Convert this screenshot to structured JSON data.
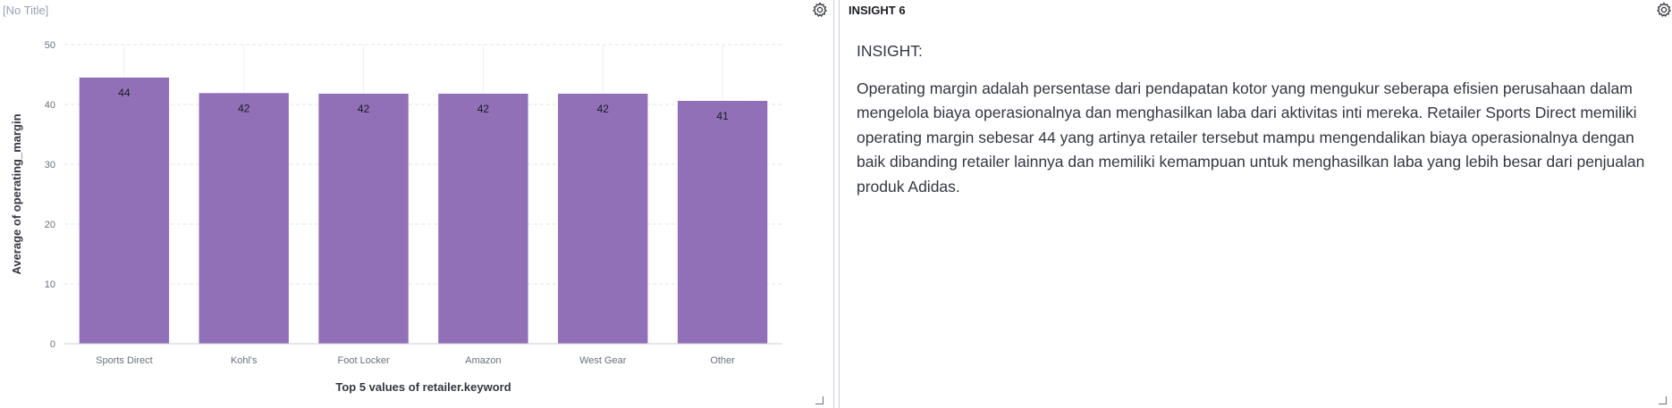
{
  "left_panel": {
    "title": "[No Title]",
    "settings_icon": "gear-icon"
  },
  "right_panel": {
    "title": "INSIGHT 6",
    "settings_icon": "gear-icon",
    "heading": "INSIGHT:",
    "paragraph": "Operating margin adalah persentase dari pendapatan kotor yang mengukur seberapa efisien perusahaan dalam mengelola biaya operasionalnya dan menghasilkan laba dari aktivitas inti mereka. Retailer Sports Direct memiliki operating margin sebesar 44 yang artinya retailer tersebut mampu mengendalikan biaya operasionalnya dengan baik dibanding retailer lainnya dan memiliki kemampuan untuk menghasilkan laba yang lebih besar dari penjualan produk Adidas."
  },
  "chart_data": {
    "type": "bar",
    "categories": [
      "Sports Direct",
      "Kohl's",
      "Foot Locker",
      "Amazon",
      "West Gear",
      "Other"
    ],
    "values": [
      44.5,
      41.9,
      41.8,
      41.8,
      41.8,
      40.6
    ],
    "data_labels": [
      "44",
      "42",
      "42",
      "42",
      "42",
      "41"
    ],
    "xlabel": "Top 5 values of retailer.keyword",
    "ylabel": "Average of operating_margin",
    "ylim": [
      0,
      50
    ],
    "yticks": [
      "0",
      "10",
      "20",
      "30",
      "40",
      "50"
    ],
    "grid": true,
    "bar_color": "#9170b8"
  }
}
